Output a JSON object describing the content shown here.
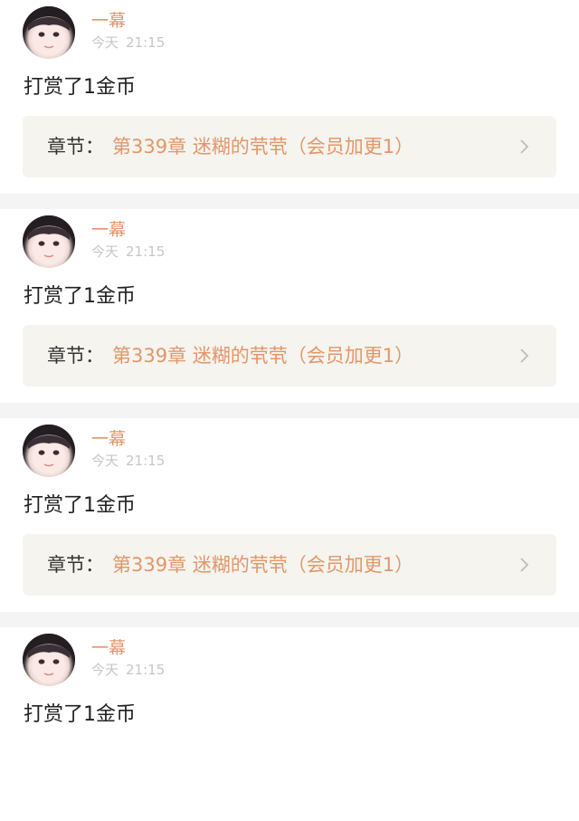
{
  "posts": [
    {
      "username": "一幕",
      "date": "今天",
      "time": "21:15",
      "content": "打赏了1金币",
      "chapter_label": "章节：",
      "chapter_title": "第339章 迷糊的茕茕（会员加更1）"
    },
    {
      "username": "一幕",
      "date": "今天",
      "time": "21:15",
      "content": "打赏了1金币",
      "chapter_label": "章节：",
      "chapter_title": "第339章 迷糊的茕茕（会员加更1）"
    },
    {
      "username": "一幕",
      "date": "今天",
      "time": "21:15",
      "content": "打赏了1金币",
      "chapter_label": "章节：",
      "chapter_title": "第339章 迷糊的茕茕（会员加更1）"
    },
    {
      "username": "一幕",
      "date": "今天",
      "time": "21:15",
      "content": "打赏了1金币"
    }
  ],
  "colors": {
    "accent": "#e2966b",
    "chapter_bg": "#f5f4ee",
    "divider": "#f4f4f4",
    "meta_text": "#c7c7c7"
  },
  "icons": {
    "avatar": "avatar-photo",
    "chapter_arrow": "chevron-right-icon"
  }
}
